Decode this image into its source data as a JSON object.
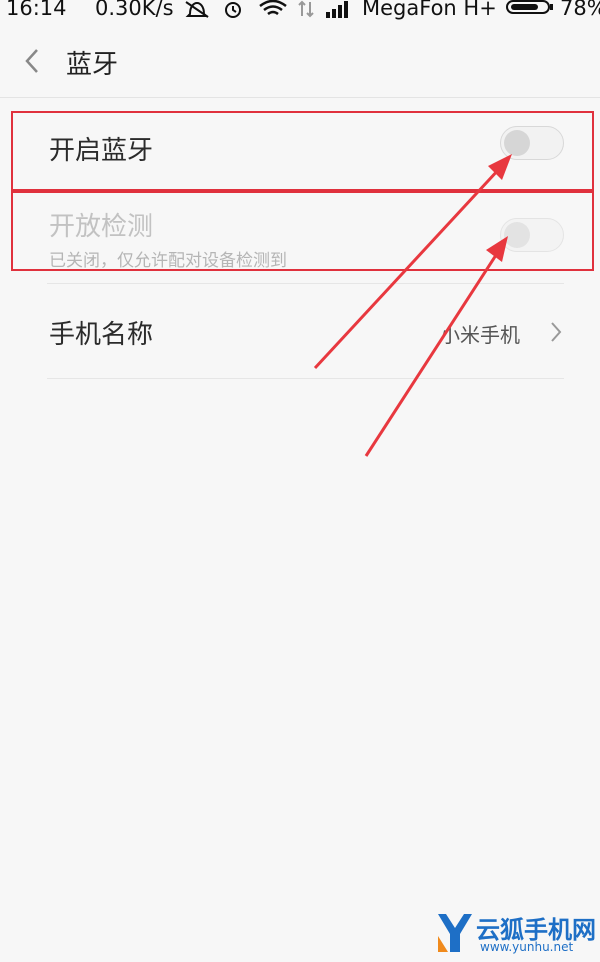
{
  "status_bar": {
    "time": "16:14",
    "speed": "0.30K/s",
    "carrier": "MegaFon H+",
    "battery_percent": "78%",
    "battery_level": 0.78,
    "icons": [
      "mute-icon",
      "alarm-icon",
      "wifi-icon",
      "data-transfer-icon",
      "signal-icon",
      "battery-icon"
    ]
  },
  "header": {
    "back_icon": "chevron-left-icon",
    "title": "蓝牙"
  },
  "settings": {
    "bluetooth": {
      "label": "开启蓝牙",
      "enabled": false
    },
    "visibility": {
      "label": "开放检测",
      "sublabel": "已关闭，仅允许配对设备检测到",
      "enabled": false
    },
    "device_name": {
      "label": "手机名称",
      "value": "小米手机"
    }
  },
  "annotations": {
    "highlight_color": "#e0313d",
    "arrow_color": "#e8383f"
  },
  "watermark": {
    "title": "云狐手机网",
    "url": "www.yunhu.net"
  }
}
